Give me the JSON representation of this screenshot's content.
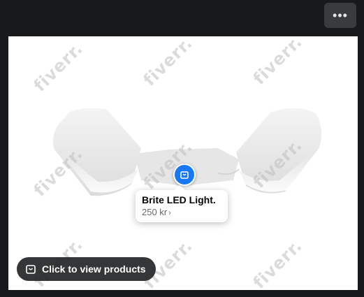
{
  "header": {
    "more_icon": "more-horizontal-icon",
    "more_glyph": "•••"
  },
  "product_tag": {
    "icon": "shopping-bag-icon",
    "name": "Brite LED Light.",
    "price": "250 kr",
    "chevron": "›"
  },
  "view_products_button": {
    "icon": "shopping-bag-icon",
    "label": "Click to view products"
  },
  "watermark": {
    "text": "fiverr.",
    "color": "#bebebe"
  },
  "colors": {
    "accent": "#1877f2",
    "background": "#18191a"
  }
}
